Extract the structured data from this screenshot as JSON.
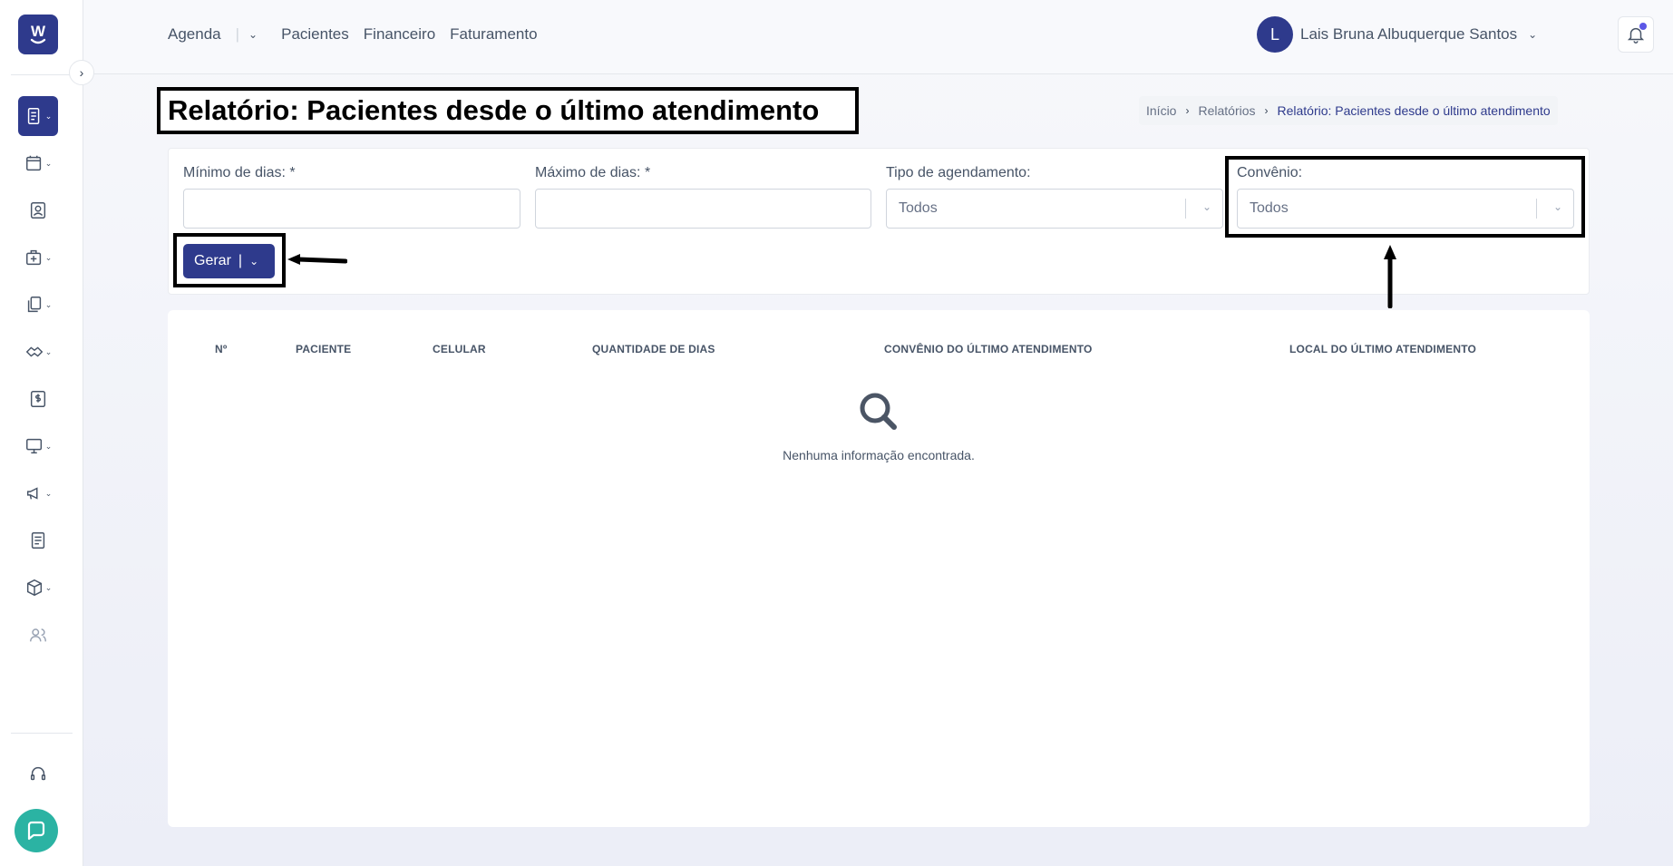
{
  "logo": {
    "letter": "W"
  },
  "nav": {
    "agenda": "Agenda",
    "pacientes": "Pacientes",
    "financeiro": "Financeiro",
    "faturamento": "Faturamento"
  },
  "user": {
    "initial": "L",
    "name": "Lais Bruna Albuquerque Santos"
  },
  "page": {
    "title": "Relatório: Pacientes desde o último atendimento"
  },
  "breadcrumb": {
    "home": "Início",
    "reports": "Relatórios",
    "current": "Relatório: Pacientes desde o último atendimento"
  },
  "filters": {
    "min_days_label": "Mínimo de dias: *",
    "min_days_value": "",
    "max_days_label": "Máximo de dias: *",
    "max_days_value": "",
    "schedule_type_label": "Tipo de agendamento:",
    "schedule_type_value": "Todos",
    "insurance_label": "Convênio:",
    "insurance_value": "Todos"
  },
  "actions": {
    "generate_label": "Gerar"
  },
  "table": {
    "columns": [
      "Nº",
      "PACIENTE",
      "CELULAR",
      "QUANTIDADE DE DIAS",
      "CONVÊNIO DO ÚLTIMO ATENDIMENTO",
      "LOCAL DO ÚLTIMO ATENDIMENTO"
    ],
    "empty_message": "Nenhuma informação encontrada."
  },
  "icons": {
    "sidebar": [
      "report-icon",
      "calendar-icon",
      "patient-card-icon",
      "medical-kit-icon",
      "documents-icon",
      "handshake-icon",
      "billing-icon",
      "monitor-icon",
      "megaphone-icon",
      "news-icon",
      "box-icon",
      "users-icon",
      "headset-icon"
    ]
  },
  "colors": {
    "primary": "#2e3a8c",
    "chat": "#2bb3a3",
    "notification_dot": "#5b57e6"
  }
}
